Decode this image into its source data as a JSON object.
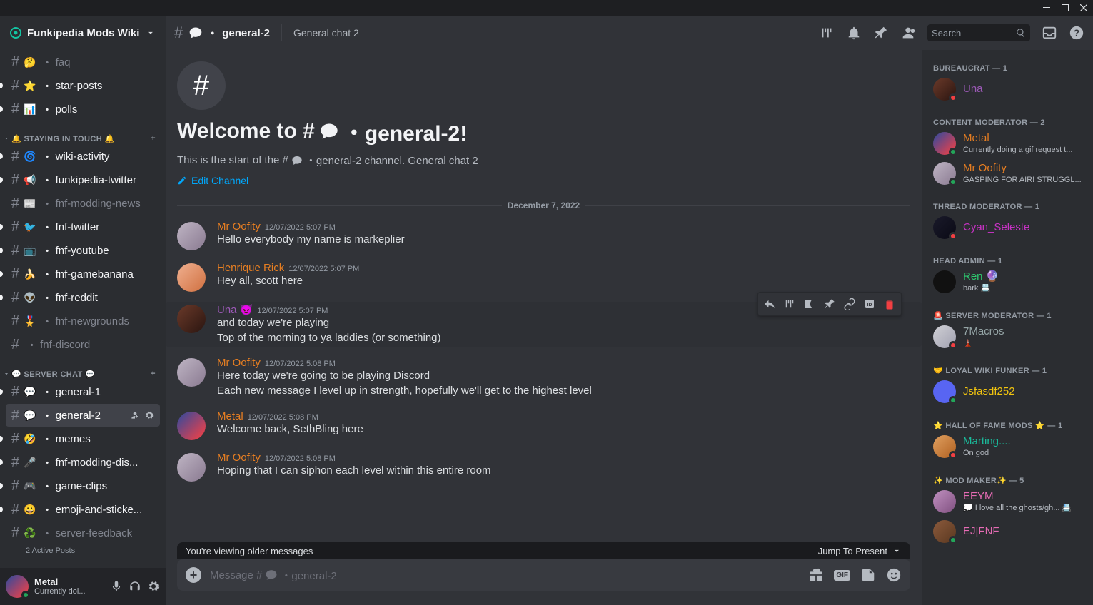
{
  "server": {
    "name": "Funkipedia Mods Wiki"
  },
  "channel": {
    "name_prefix": "#",
    "name": "general-2",
    "topic": "General chat 2",
    "welcome_title_pre": "Welcome to #",
    "welcome_title_post": "・general-2!",
    "welcome_sub_pre": "This is the start of the #",
    "welcome_sub_post": "・general-2 channel. General chat 2",
    "edit": "Edit Channel"
  },
  "search": {
    "placeholder": "Search"
  },
  "categories": [
    {
      "name": "🔔 STAYING IN TOUCH 🔔",
      "add": true
    },
    {
      "name": "💬 SERVER CHAT 💬",
      "add": true
    }
  ],
  "channels_top": [
    {
      "emoji": "🤔",
      "name": "faq",
      "unread": false
    },
    {
      "emoji": "⭐",
      "name": "star-posts",
      "unread": true
    },
    {
      "emoji": "📊",
      "name": "polls",
      "unread": true
    }
  ],
  "channels_cat1": [
    {
      "emoji": "🌀",
      "name": "wiki-activity",
      "unread": true
    },
    {
      "emoji": "📢",
      "name": "funkipedia-twitter",
      "unread": true
    },
    {
      "emoji": "📰",
      "name": "fnf-modding-news",
      "unread": false
    },
    {
      "emoji": "🐦",
      "name": "fnf-twitter",
      "unread": true
    },
    {
      "emoji": "📺",
      "name": "fnf-youtube",
      "unread": true
    },
    {
      "emoji": "🍌",
      "name": "fnf-gamebanana",
      "unread": true
    },
    {
      "emoji": "👽",
      "name": "fnf-reddit",
      "unread": true
    },
    {
      "emoji": "🎖️",
      "name": "fnf-newgrounds",
      "unread": false
    },
    {
      "emoji": "",
      "name": "fnf-discord",
      "unread": false
    }
  ],
  "channels_cat2": [
    {
      "emoji": "💬",
      "name": "general-1",
      "unread": true,
      "selected": false
    },
    {
      "emoji": "💬",
      "name": "general-2",
      "unread": false,
      "selected": true
    },
    {
      "emoji": "🤣",
      "name": "memes",
      "unread": true
    },
    {
      "emoji": "🎤",
      "name": "fnf-modding-dis...",
      "unread": true
    },
    {
      "emoji": "🎮",
      "name": "game-clips",
      "unread": true
    },
    {
      "emoji": "😀",
      "name": "emoji-and-sticke...",
      "unread": true
    },
    {
      "emoji": "♻️",
      "name": "server-feedback",
      "unread": false
    }
  ],
  "active_posts": "2 Active Posts",
  "user": {
    "name": "Metal",
    "status": "Currently doi..."
  },
  "date_divider": "December 7, 2022",
  "messages": [
    {
      "author": "Mr Oofity",
      "color": "c-orange",
      "ts": "12/07/2022 5:07 PM",
      "lines": [
        "Hello everybody my name is markeplier"
      ],
      "avatar": "linear-gradient(135deg,#bfb5c4,#8a7a91)"
    },
    {
      "author": "Henrique Rick",
      "color": "c-orange",
      "ts": "12/07/2022 5:07 PM",
      "lines": [
        "Hey all, scott here"
      ],
      "avatar": "linear-gradient(135deg,#f0b090,#d07040)"
    },
    {
      "author": "Una",
      "color": "c-purple",
      "ts": "12/07/2022 5:07 PM",
      "lines": [
        "and today we're playing",
        "Top of the morning to ya laddies (or something)"
      ],
      "avatar": "linear-gradient(135deg,#6b3a2a,#2a1510)",
      "hover": true,
      "badge": "😈"
    },
    {
      "author": "Mr Oofity",
      "color": "c-orange",
      "ts": "12/07/2022 5:08 PM",
      "lines": [
        "Here today we're going to be playing Discord",
        "Each new message I level up in strength, hopefully we'll get to the highest level"
      ],
      "avatar": "linear-gradient(135deg,#bfb5c4,#8a7a91)"
    },
    {
      "author": "Metal",
      "color": "c-orange",
      "ts": "12/07/2022 5:08 PM",
      "lines": [
        "Welcome back, SethBling here"
      ],
      "avatar": "linear-gradient(135deg,#2a4aa0,#ff4040)"
    },
    {
      "author": "Mr Oofity",
      "color": "c-orange",
      "ts": "12/07/2022 5:08 PM",
      "lines": [
        "Hoping that I can siphon each level within this entire room"
      ],
      "avatar": "linear-gradient(135deg,#bfb5c4,#8a7a91)"
    }
  ],
  "older": {
    "left": "You're viewing older messages",
    "right": "Jump To Present"
  },
  "input": {
    "placeholder_pre": "Message #",
    "placeholder_post": "・general-2"
  },
  "roles": [
    {
      "name": "BUREAUCRAT — 1",
      "members": [
        {
          "name": "Una",
          "color": "c-purple",
          "status": "dnd",
          "avatar": "linear-gradient(135deg,#6b3a2a,#2a1510)"
        }
      ]
    },
    {
      "name": "CONTENT MODERATOR — 2",
      "members": [
        {
          "name": "Metal",
          "color": "c-orange",
          "status": "online",
          "sub": "Currently doing a gif request t...",
          "avatar": "linear-gradient(135deg,#2a4aa0,#ff4040)"
        },
        {
          "name": "Mr Oofity",
          "color": "c-orange",
          "status": "online",
          "sub": "GASPING FOR AIR! STRUGGL...",
          "avatar": "linear-gradient(135deg,#bfb5c4,#8a7a91)"
        }
      ]
    },
    {
      "name": "THREAD MODERATOR — 1",
      "members": [
        {
          "name": "Cyan_Seleste",
          "color": "c-magenta",
          "status": "dnd",
          "avatar": "linear-gradient(135deg,#1a1a2a,#0a0a15)"
        }
      ]
    },
    {
      "name": "HEAD ADMIN — 1",
      "members": [
        {
          "name": "Ren 🔮",
          "color": "c-green",
          "status": "none",
          "sub": "bark 📇",
          "avatar": "#111"
        }
      ]
    },
    {
      "name": "🚨 SERVER MODERATOR — 1",
      "members": [
        {
          "name": "7Macros",
          "color": "c-gray",
          "status": "dnd",
          "sub": "🗼",
          "avatar": "linear-gradient(135deg,#d0d0d5,#a0a0b0)"
        }
      ]
    },
    {
      "name": "🤝 LOYAL WIKI FUNKER — 1",
      "members": [
        {
          "name": "Jsfasdf252",
          "color": "c-gold",
          "status": "online",
          "avatar": "#5865f2"
        }
      ]
    },
    {
      "name": "⭐ HALL OF FAME MODS ⭐ — 1",
      "members": [
        {
          "name": "Marting....",
          "color": "c-teal",
          "status": "dnd",
          "sub": "On god",
          "avatar": "linear-gradient(135deg,#e0a060,#b06020)"
        }
      ]
    },
    {
      "name": "✨ MOD MAKER✨ — 5",
      "members": [
        {
          "name": "EEYM",
          "color": "c-pink",
          "status": "none",
          "sub": "💭 I love all the ghosts/gh... 📇",
          "avatar": "linear-gradient(135deg,#c090c0,#805080)"
        },
        {
          "name": "EJ|FNF",
          "color": "c-pink",
          "status": "online",
          "avatar": "linear-gradient(135deg,#8b5a3c,#5a3820)"
        }
      ]
    }
  ]
}
